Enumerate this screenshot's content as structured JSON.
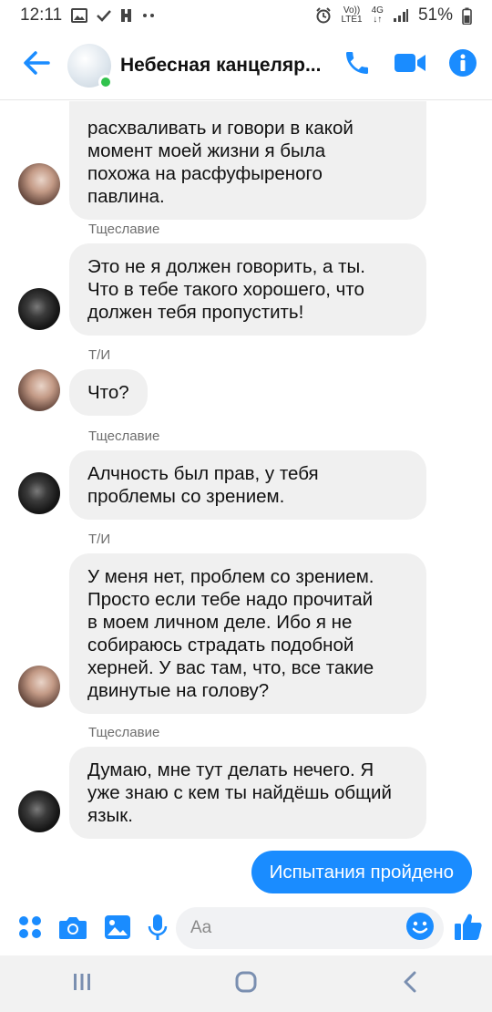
{
  "status_bar": {
    "time": "12:11",
    "net_top": "Vo))",
    "net_bottom": "LTE1",
    "net_type": "4G",
    "battery": "51%"
  },
  "header": {
    "title": "Небесная канцеляр...",
    "online": true,
    "accent_color": "#1a8cff"
  },
  "messages": [
    {
      "sender": "",
      "lines": [
        "расхваливать и говори в какой",
        "момент моей жизни я  была",
        "похожа на расфуфыреного",
        "павлина."
      ]
    },
    {
      "sender": "Тщеславие",
      "lines": [
        "Это не я должен говорить, а ты.",
        "Что в тебе такого хорошего, что",
        "должен тебя пропустить!"
      ]
    },
    {
      "sender": "Т/И",
      "lines": [
        "Что?"
      ]
    },
    {
      "sender": "Тщеславие",
      "lines": [
        "Алчность был прав, у тебя",
        "проблемы со зрением."
      ]
    },
    {
      "sender": "Т/И",
      "lines": [
        "У меня нет, проблем со зрением.",
        "Просто если тебе надо прочитай",
        "в моем личном деле. Ибо я не",
        "собираюсь страдать подобной",
        "херней. У вас там, что, все такие",
        "двинутые на голову?"
      ]
    },
    {
      "sender": "Тщеславие",
      "lines": [
        "Думаю, мне тут делать нечего. Я",
        "уже знаю с кем ты найдёшь общий",
        "язык."
      ]
    }
  ],
  "my_message": "Испытания пройдено",
  "composer": {
    "placeholder": "Aa"
  },
  "icons": {
    "back": "arrow-left-icon",
    "call": "phone-icon",
    "video": "video-camera-icon",
    "info": "info-icon",
    "menu": "four-dots-icon",
    "camera": "camera-icon",
    "gallery": "image-icon",
    "mic": "microphone-icon",
    "emoji": "smiley-icon",
    "like": "thumbs-up-icon"
  }
}
